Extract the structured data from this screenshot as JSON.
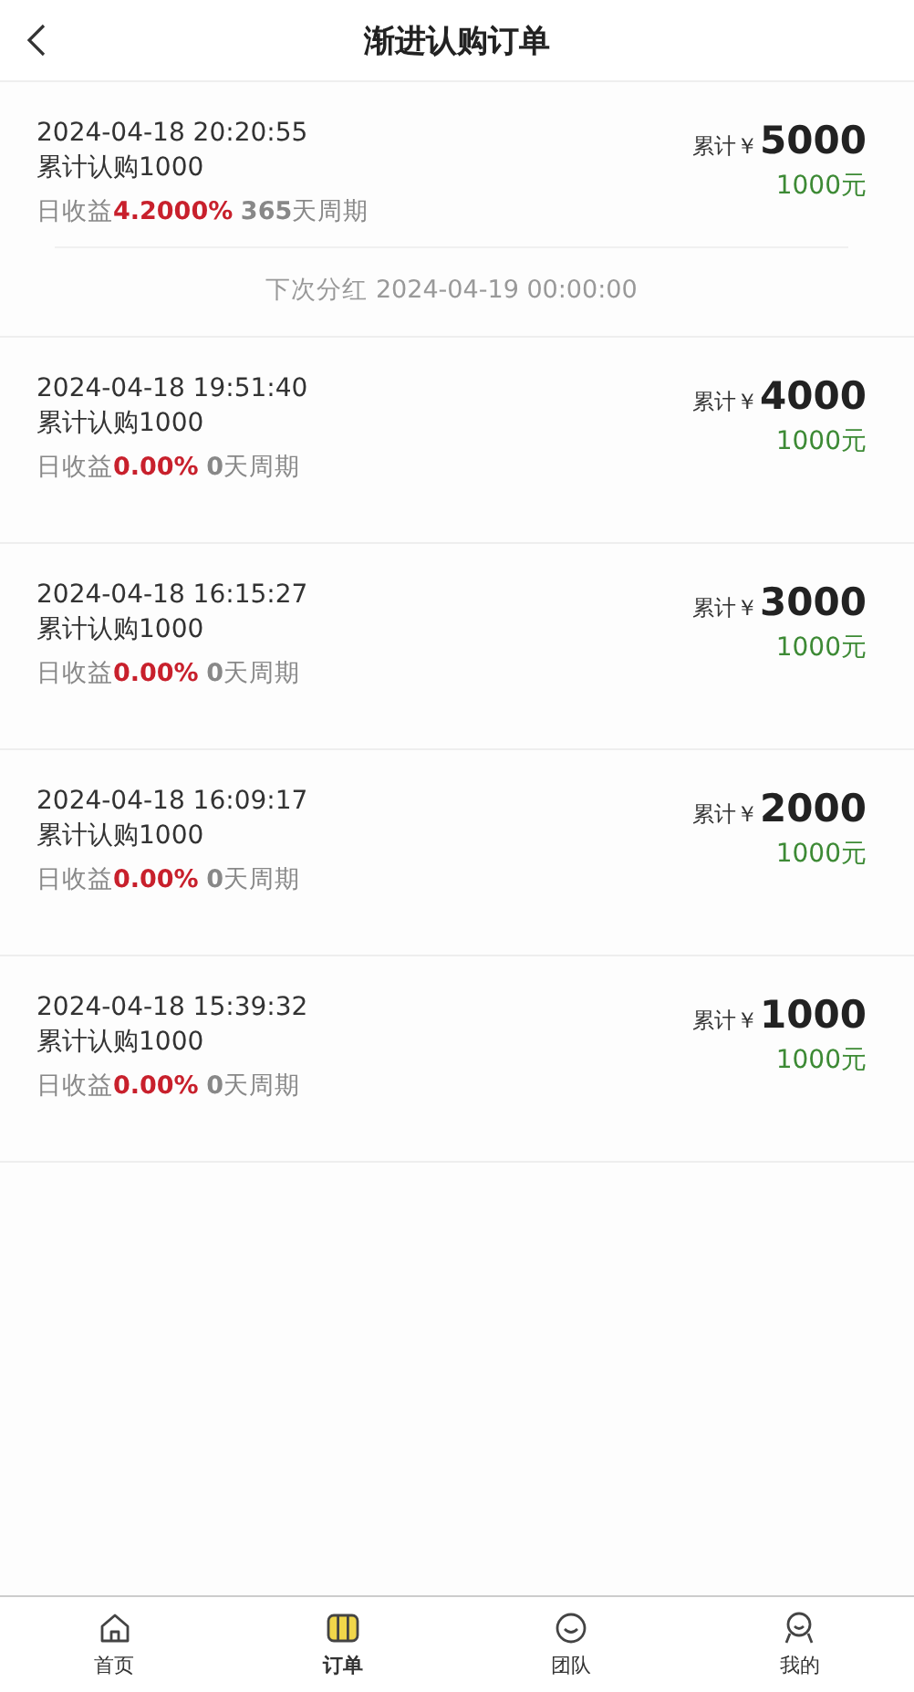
{
  "header": {
    "title": "渐进认购订单"
  },
  "orders": [
    {
      "time": "2024-04-18 20:20:55",
      "subscribed": "累计认购1000",
      "yield_label": "日收益",
      "rate": "4.2000%",
      "days": "365",
      "days_suffix": "天周期",
      "total_label": "累计￥",
      "total": "5000",
      "amount": "1000元",
      "next_dividend": "下次分红 2024-04-19 00:00:00"
    },
    {
      "time": "2024-04-18 19:51:40",
      "subscribed": "累计认购1000",
      "yield_label": "日收益",
      "rate": "0.00%",
      "days": "0",
      "days_suffix": "天周期",
      "total_label": "累计￥",
      "total": "4000",
      "amount": "1000元"
    },
    {
      "time": "2024-04-18 16:15:27",
      "subscribed": "累计认购1000",
      "yield_label": "日收益",
      "rate": "0.00%",
      "days": "0",
      "days_suffix": "天周期",
      "total_label": "累计￥",
      "total": "3000",
      "amount": "1000元"
    },
    {
      "time": "2024-04-18 16:09:17",
      "subscribed": "累计认购1000",
      "yield_label": "日收益",
      "rate": "0.00%",
      "days": "0",
      "days_suffix": "天周期",
      "total_label": "累计￥",
      "total": "2000",
      "amount": "1000元"
    },
    {
      "time": "2024-04-18 15:39:32",
      "subscribed": "累计认购1000",
      "yield_label": "日收益",
      "rate": "0.00%",
      "days": "0",
      "days_suffix": "天周期",
      "total_label": "累计￥",
      "total": "1000",
      "amount": "1000元"
    }
  ],
  "tabbar": [
    {
      "kind": "home",
      "label": "首页",
      "selected": false
    },
    {
      "kind": "orders",
      "label": "订单",
      "selected": true
    },
    {
      "kind": "team",
      "label": "团队",
      "selected": false
    },
    {
      "kind": "profile",
      "label": "我的",
      "selected": false
    }
  ]
}
